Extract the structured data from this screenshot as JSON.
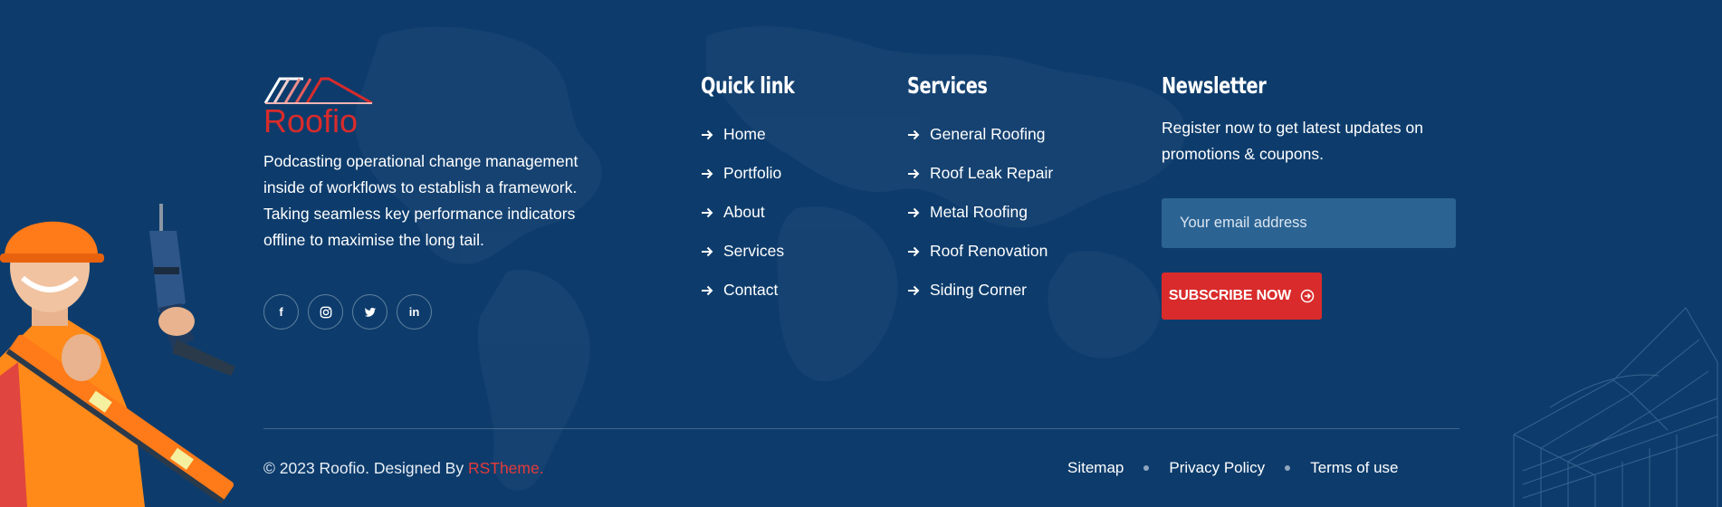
{
  "brand": {
    "logo_text": "Roofio",
    "description": "Podcasting operational change management inside of workflows to establish a framework. Taking seamless key performance indicators offline to maximise the long tail.",
    "social": [
      {
        "icon": "facebook-icon",
        "glyph": "f"
      },
      {
        "icon": "instagram-icon",
        "glyph": ""
      },
      {
        "icon": "twitter-icon",
        "glyph": ""
      },
      {
        "icon": "linkedin-icon",
        "glyph": "in"
      }
    ]
  },
  "quick_links": {
    "title": "Quick link",
    "items": [
      "Home",
      "Portfolio",
      "About",
      "Services",
      "Contact"
    ]
  },
  "services": {
    "title": "Services",
    "items": [
      "General Roofing",
      "Roof Leak Repair",
      "Metal Roofing",
      "Roof Renovation",
      "Siding Corner"
    ]
  },
  "newsletter": {
    "title": "Newsletter",
    "description": "Register now to get latest updates on promotions & coupons.",
    "email_placeholder": "Your email address",
    "button_label": "SUBSCRIBE NOW"
  },
  "footer_bottom": {
    "copyright_prefix": "© 2023 Roofio. Designed By ",
    "copyright_link": "RSTheme.",
    "links": [
      "Sitemap",
      "Privacy Policy",
      "Terms of use"
    ]
  },
  "colors": {
    "background": "#0d3c6c",
    "accent": "#d92b2b",
    "input_bg": "#2b6393"
  }
}
